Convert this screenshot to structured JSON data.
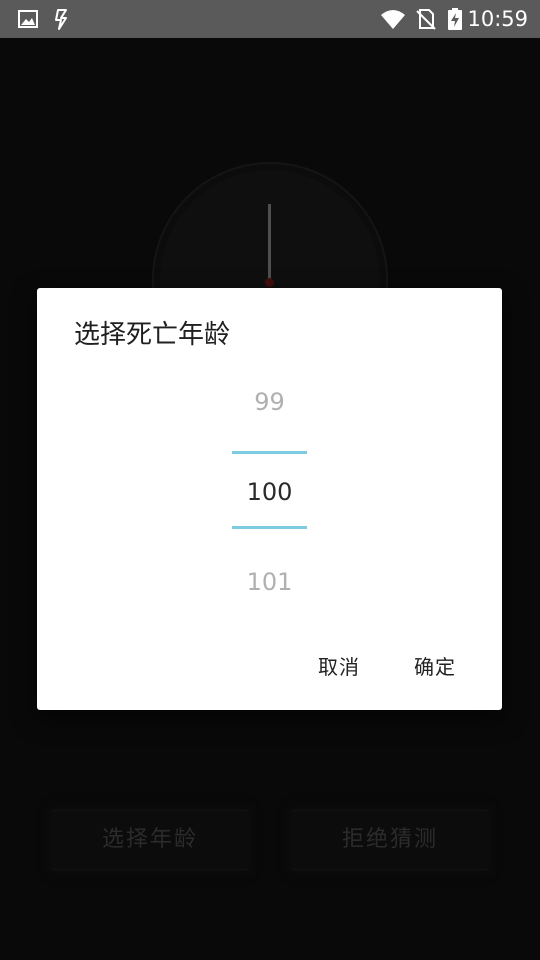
{
  "status_bar": {
    "time": "10:59",
    "icons": [
      "image-icon",
      "lightning-app-icon",
      "wifi-icon",
      "no-sim-icon",
      "battery-charging-icon"
    ]
  },
  "background": {
    "buttons": {
      "select_age": "选择年龄",
      "refuse_guess": "拒绝猜测"
    }
  },
  "dialog": {
    "title": "选择死亡年龄",
    "picker": {
      "previous": "99",
      "current": "100",
      "next": "101"
    },
    "cancel_label": "取消",
    "ok_label": "确定"
  },
  "colors": {
    "accent_divider": "#7ccbe0",
    "status_bar_bg": "#5a5a5a",
    "dialog_bg": "#ffffff"
  }
}
